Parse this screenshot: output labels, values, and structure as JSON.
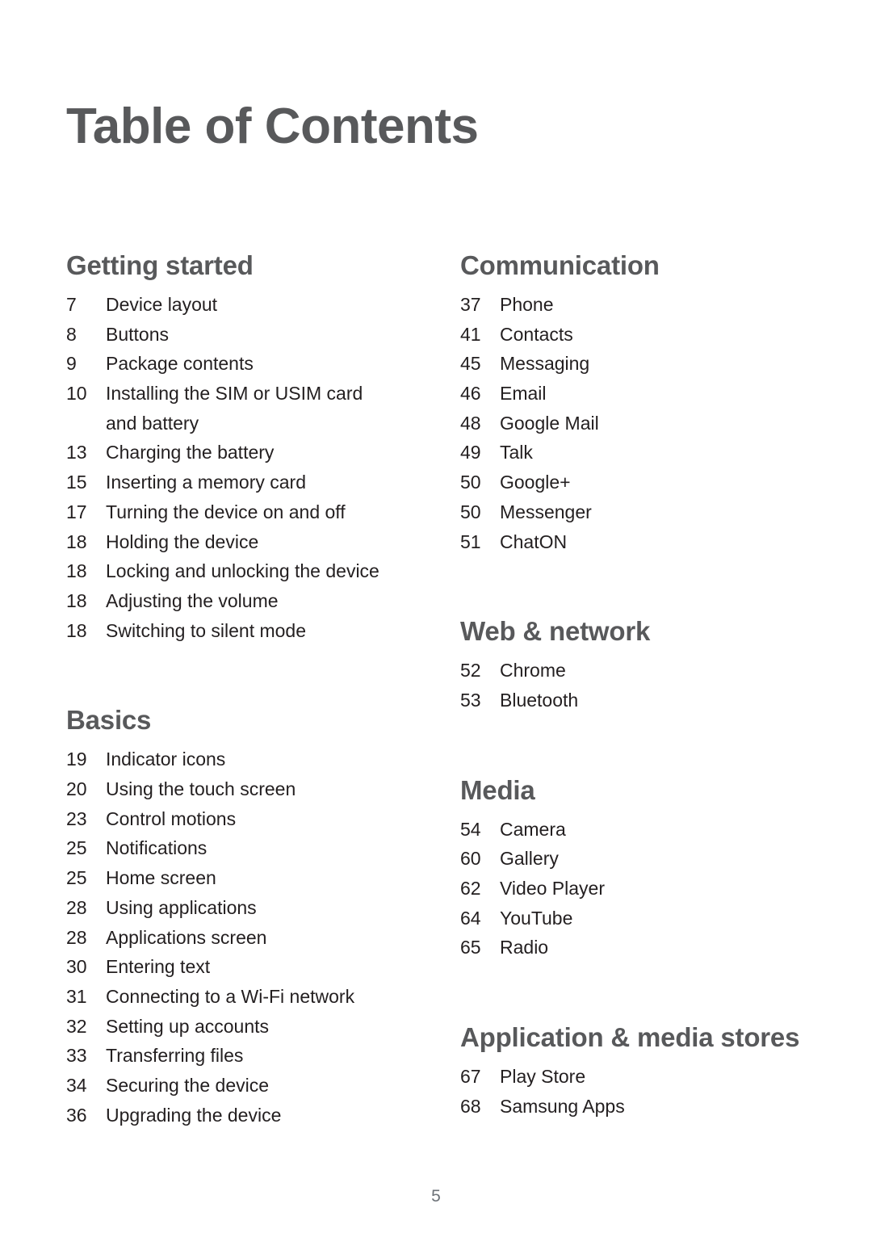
{
  "document": {
    "title": "Table of Contents",
    "page_number": "5",
    "heading_color": "#58595b",
    "body_color": "#231f20",
    "folio_color": "#6d7278",
    "background_color": "#ffffff"
  },
  "columns": [
    {
      "name": "left-column",
      "sections": [
        {
          "heading": "Getting started",
          "entries": [
            {
              "page": "7",
              "title": "Device layout"
            },
            {
              "page": "8",
              "title": "Buttons"
            },
            {
              "page": "9",
              "title": "Package contents"
            },
            {
              "page": "10",
              "title": "Installing the SIM or USIM card and battery"
            },
            {
              "page": "13",
              "title": "Charging the battery"
            },
            {
              "page": "15",
              "title": "Inserting a memory card"
            },
            {
              "page": "17",
              "title": "Turning the device on and off"
            },
            {
              "page": "18",
              "title": "Holding the device"
            },
            {
              "page": "18",
              "title": "Locking and unlocking the device"
            },
            {
              "page": "18",
              "title": "Adjusting the volume"
            },
            {
              "page": "18",
              "title": "Switching to silent mode"
            }
          ]
        },
        {
          "heading": "Basics",
          "entries": [
            {
              "page": "19",
              "title": "Indicator icons"
            },
            {
              "page": "20",
              "title": "Using the touch screen"
            },
            {
              "page": "23",
              "title": "Control motions"
            },
            {
              "page": "25",
              "title": "Notifications"
            },
            {
              "page": "25",
              "title": "Home screen"
            },
            {
              "page": "28",
              "title": "Using applications"
            },
            {
              "page": "28",
              "title": "Applications screen"
            },
            {
              "page": "30",
              "title": "Entering text"
            },
            {
              "page": "31",
              "title": "Connecting to a Wi-Fi network"
            },
            {
              "page": "32",
              "title": "Setting up accounts"
            },
            {
              "page": "33",
              "title": "Transferring files"
            },
            {
              "page": "34",
              "title": "Securing the device"
            },
            {
              "page": "36",
              "title": "Upgrading the device"
            }
          ]
        }
      ]
    },
    {
      "name": "right-column",
      "sections": [
        {
          "heading": "Communication",
          "entries": [
            {
              "page": "37",
              "title": "Phone"
            },
            {
              "page": "41",
              "title": "Contacts"
            },
            {
              "page": "45",
              "title": "Messaging"
            },
            {
              "page": "46",
              "title": "Email"
            },
            {
              "page": "48",
              "title": "Google Mail"
            },
            {
              "page": "49",
              "title": "Talk"
            },
            {
              "page": "50",
              "title": "Google+"
            },
            {
              "page": "50",
              "title": "Messenger"
            },
            {
              "page": "51",
              "title": "ChatON"
            }
          ]
        },
        {
          "heading": "Web & network",
          "entries": [
            {
              "page": "52",
              "title": "Chrome"
            },
            {
              "page": "53",
              "title": "Bluetooth"
            }
          ]
        },
        {
          "heading": "Media",
          "entries": [
            {
              "page": "54",
              "title": "Camera"
            },
            {
              "page": "60",
              "title": "Gallery"
            },
            {
              "page": "62",
              "title": "Video Player"
            },
            {
              "page": "64",
              "title": "YouTube"
            },
            {
              "page": "65",
              "title": "Radio"
            }
          ]
        },
        {
          "heading": "Application & media stores",
          "entries": [
            {
              "page": "67",
              "title": "Play Store"
            },
            {
              "page": "68",
              "title": "Samsung Apps"
            }
          ]
        }
      ]
    }
  ]
}
